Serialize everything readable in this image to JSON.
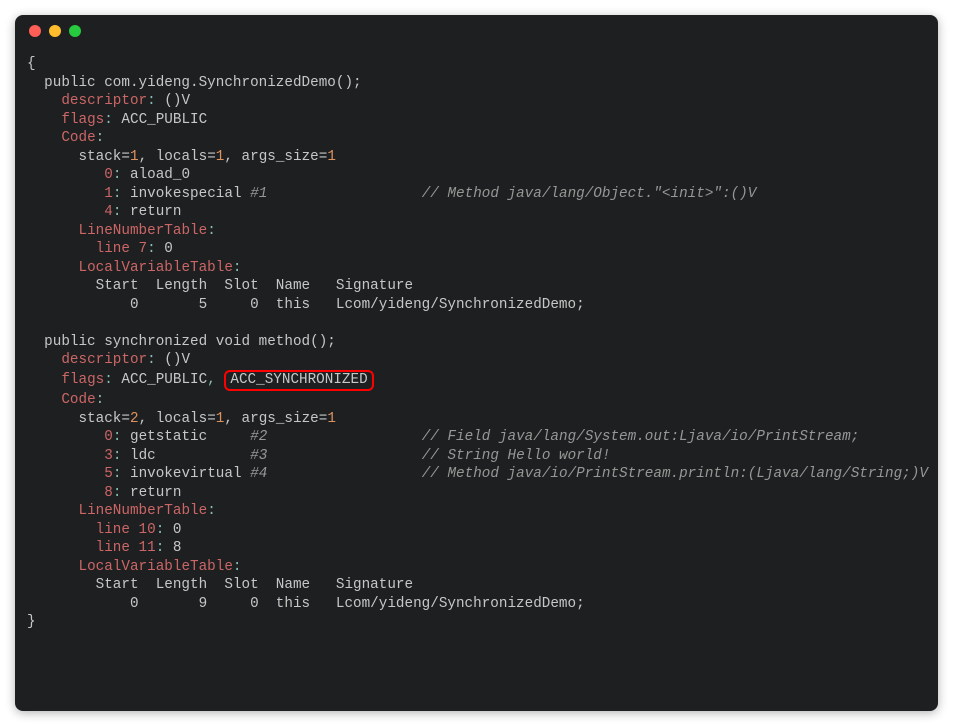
{
  "code": {
    "open_brace": "{",
    "m1_sig": "  public com.yideng.SynchronizedDemo();",
    "desc_k": "descriptor",
    "m1_desc_v": " ()V",
    "flags_k": "flags",
    "m1_flags_v": " ACC_PUBLIC",
    "code_k": "Code",
    "m1_stack": "      stack=",
    "m1_stack_sep": ", locals=",
    "m1_stack_sep2": ", args_size=",
    "one": "1",
    "two": "2",
    "m1_i0_n": "0",
    "m1_i0_t": " aload_0",
    "m1_i1_n": "1",
    "m1_i1_t": " invokespecial ",
    "m1_i1_ref": "#1",
    "m1_i1_c": "// Method java/lang/Object.\"<init>\":()V",
    "m1_i4_n": "4",
    "m1_i4_t": " return",
    "lnt_k": "LineNumberTable",
    "m1_ln": "line 7",
    "m1_ln_v": " 0",
    "lvt_k": "LocalVariableTable",
    "lvt_hdr": "        Start  Length  Slot  Name   Signature",
    "m1_lvt_row": "            0       5     0  this   Lcom/yideng/SynchronizedDemo;",
    "m2_sig": "  public synchronized void method();",
    "m2_desc_v": " ()V",
    "m2_flags_v1": " ACC_PUBLIC",
    "m2_flags_v2": "ACC_SYNCHRONIZED",
    "m2_i0_n": "0",
    "m2_i0_t": " getstatic     ",
    "m2_i0_ref": "#2",
    "m2_i0_c": "// Field java/lang/System.out:Ljava/io/PrintStream;",
    "m2_i3_n": "3",
    "m2_i3_t": " ldc           ",
    "m2_i3_ref": "#3",
    "m2_i3_c": "// String Hello world!",
    "m2_i5_n": "5",
    "m2_i5_t": " invokevirtual ",
    "m2_i5_ref": "#4",
    "m2_i5_c": "// Method java/io/PrintStream.println:(Ljava/lang/String;)V",
    "m2_i8_n": "8",
    "m2_i8_t": " return",
    "m2_ln1": "line 10",
    "m2_ln1_v": " 0",
    "m2_ln2": "line 11",
    "m2_ln2_v": " 8",
    "m2_lvt_row": "            0       9     0  this   Lcom/yideng/SynchronizedDemo;",
    "close_brace": "}"
  }
}
